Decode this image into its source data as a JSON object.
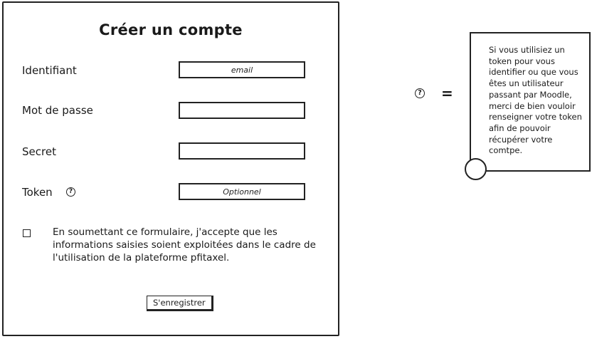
{
  "form": {
    "title": "Créer un compte",
    "fields": [
      {
        "label": "Identifiant",
        "value": "",
        "placeholder": "email"
      },
      {
        "label": "Mot de passe",
        "value": "",
        "placeholder": ""
      },
      {
        "label": "Secret",
        "value": "",
        "placeholder": ""
      },
      {
        "label": "Token",
        "value": "",
        "placeholder": "Optionnel",
        "help_icon": "question-mark-circle"
      }
    ],
    "consent": {
      "checked": false,
      "text": "En soumettant ce formulaire, j'accepte que les informations saisies soient exploitées dans le cadre de l'utilisation de la plateforme pfitaxel."
    },
    "submit_label": "S'enregistrer"
  },
  "legend": {
    "icon": "question-mark-circle",
    "equals": "=",
    "note_text": "Si vous utilisiez un token pour vous identifier ou que vous êtes un utilisateur passant par Moodle, merci de bien vouloir renseigner votre token afin de pouvoir récupérer votre comtpe."
  }
}
